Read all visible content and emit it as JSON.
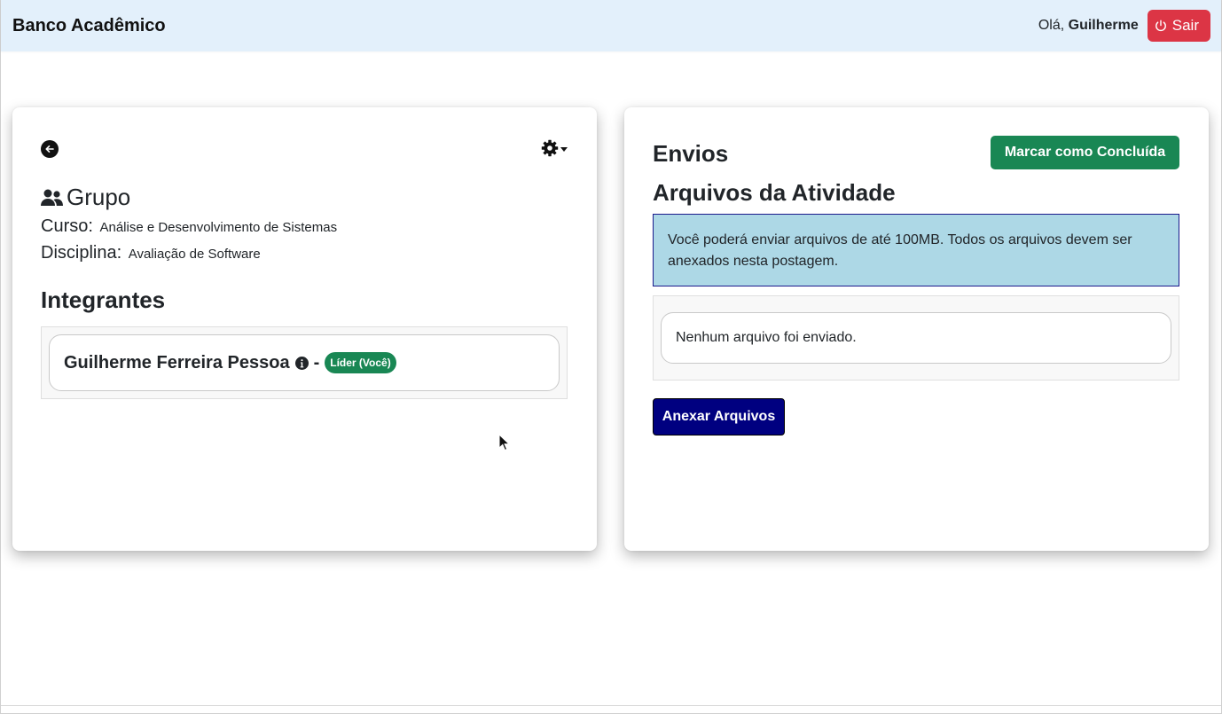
{
  "navbar": {
    "brand": "Banco Acadêmico",
    "greeting_prefix": "Olá, ",
    "user_name": "Guilherme",
    "logout_label": "Sair"
  },
  "group_card": {
    "title": "Grupo",
    "curso_label": "Curso:",
    "curso_value": "Análise e Desenvolvimento de Sistemas",
    "disciplina_label": "Disciplina:",
    "disciplina_value": "Avaliação de Software",
    "members_title": "Integrantes",
    "members": [
      {
        "name": "Guilherme Ferreira Pessoa",
        "separator": "-",
        "badge": "Líder (Você)"
      }
    ]
  },
  "submissions_card": {
    "title": "Envios",
    "mark_done_label": "Marcar como Concluída",
    "files_title": "Arquivos da Atividade",
    "alert_text": "Você poderá enviar arquivos de até 100MB. Todos os arquivos devem ser anexados nesta postagem.",
    "empty_text": "Nenhum arquivo foi enviado.",
    "attach_label": "Anexar Arquivos"
  },
  "icons": {
    "logout": "power-icon",
    "back": "arrow-left-circle-icon",
    "settings": "gear-icon",
    "group": "people-icon",
    "info": "info-circle-icon"
  },
  "colors": {
    "navbar_bg": "#e3f0fb",
    "danger": "#dc3545",
    "success": "#198754",
    "alert_bg": "#add8e6",
    "attach_bg": "#000080"
  }
}
